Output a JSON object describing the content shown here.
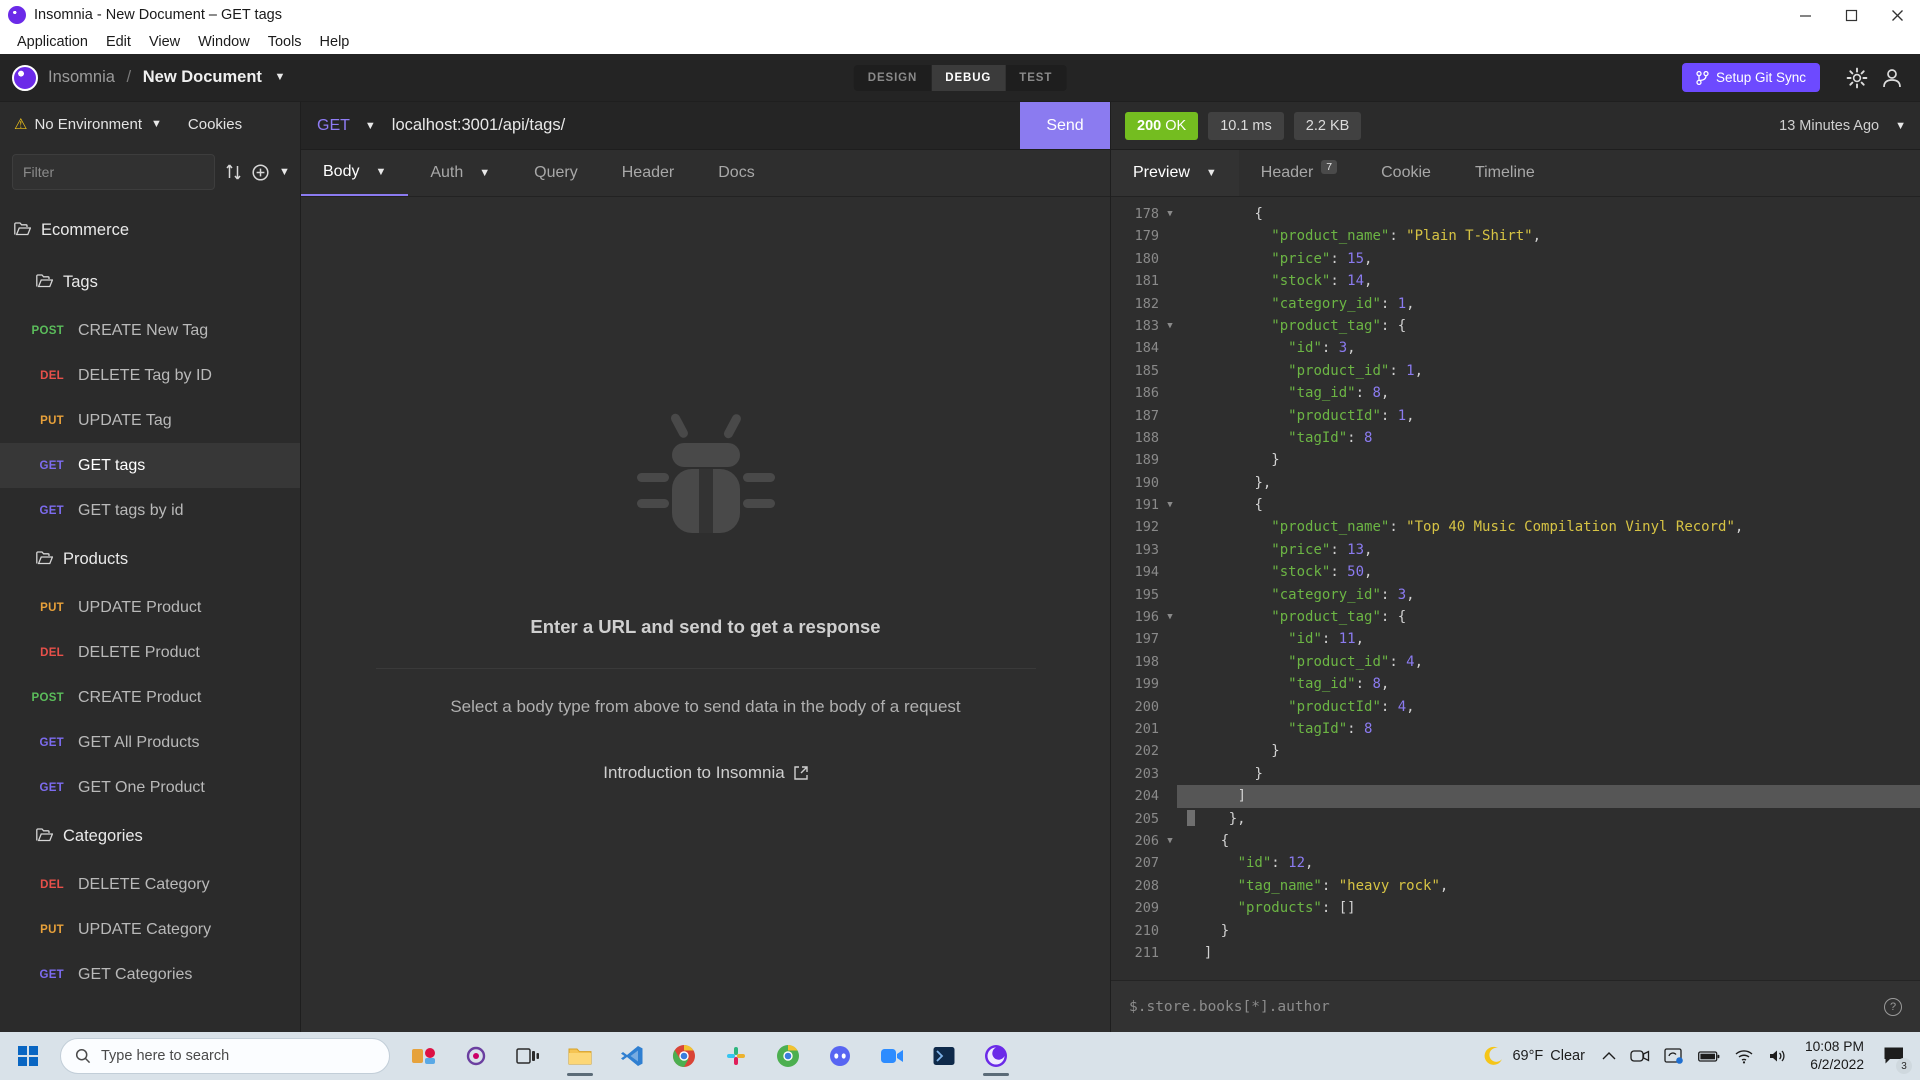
{
  "window": {
    "title": "Insomnia - New Document – GET tags",
    "minimize": "–",
    "maximize": "☐",
    "close": "✕"
  },
  "menubar": {
    "items": [
      "Application",
      "Edit",
      "View",
      "Window",
      "Tools",
      "Help"
    ]
  },
  "header": {
    "brand": "Insomnia",
    "separator": "/",
    "document": "New Document",
    "doc_caret": "▼",
    "modes": [
      {
        "label": "DESIGN",
        "active": false
      },
      {
        "label": "DEBUG",
        "active": true
      },
      {
        "label": "TEST",
        "active": false
      }
    ],
    "git_sync": "Setup Git Sync",
    "git_icon": "branch-icon",
    "settings_icon": "gear-icon",
    "account_icon": "user-icon"
  },
  "sidebar": {
    "environment": "No Environment",
    "environment_caret": "▼",
    "warning_icon": "⚠",
    "cookies": "Cookies",
    "filter_placeholder": "Filter",
    "sort_icon": "sort-icon",
    "add_icon": "plus-icon",
    "tree": [
      {
        "type": "folder",
        "level": 1,
        "label": "Ecommerce"
      },
      {
        "type": "folder",
        "level": 2,
        "label": "Tags"
      },
      {
        "type": "request",
        "method": "POST",
        "label": "CREATE New Tag",
        "selected": false
      },
      {
        "type": "request",
        "method": "DEL",
        "label": "DELETE Tag by ID",
        "selected": false
      },
      {
        "type": "request",
        "method": "PUT",
        "label": "UPDATE Tag",
        "selected": false
      },
      {
        "type": "request",
        "method": "GET",
        "label": "GET tags",
        "selected": true
      },
      {
        "type": "request",
        "method": "GET",
        "label": "GET tags by id",
        "selected": false
      },
      {
        "type": "folder",
        "level": 2,
        "label": "Products"
      },
      {
        "type": "request",
        "method": "PUT",
        "label": "UPDATE Product",
        "selected": false
      },
      {
        "type": "request",
        "method": "DEL",
        "label": "DELETE Product",
        "selected": false
      },
      {
        "type": "request",
        "method": "POST",
        "label": "CREATE Product",
        "selected": false
      },
      {
        "type": "request",
        "method": "GET",
        "label": "GET All Products",
        "selected": false
      },
      {
        "type": "request",
        "method": "GET",
        "label": "GET One Product",
        "selected": false
      },
      {
        "type": "folder",
        "level": 2,
        "label": "Categories"
      },
      {
        "type": "request",
        "method": "DEL",
        "label": "DELETE Category",
        "selected": false
      },
      {
        "type": "request",
        "method": "PUT",
        "label": "UPDATE Category",
        "selected": false
      },
      {
        "type": "request",
        "method": "GET",
        "label": "GET Categories",
        "selected": false
      }
    ]
  },
  "request": {
    "method": "GET",
    "method_caret": "▼",
    "url": "localhost:3001/api/tags/",
    "send_label": "Send",
    "tabs": [
      {
        "label": "Body",
        "active": true,
        "caret": "▼"
      },
      {
        "label": "Auth",
        "active": false,
        "caret": "▼"
      },
      {
        "label": "Query",
        "active": false,
        "caret": ""
      },
      {
        "label": "Header",
        "active": false,
        "caret": ""
      },
      {
        "label": "Docs",
        "active": false,
        "caret": ""
      }
    ],
    "empty_icon": "bug-icon",
    "empty_title": "Enter a URL and send to get a response",
    "empty_subtitle": "Select a body type from above to send data in the body of a request",
    "empty_link": "Introduction to Insomnia",
    "empty_link_icon": "external-link-icon"
  },
  "response": {
    "status_code": "200",
    "status_text": "OK",
    "time": "10.1 ms",
    "size": "2.2 KB",
    "ago": "13 Minutes Ago",
    "ago_caret": "▼",
    "tabs": [
      {
        "label": "Preview",
        "active": true,
        "caret": "▼",
        "badge": ""
      },
      {
        "label": "Header",
        "active": false,
        "caret": "",
        "badge": "7"
      },
      {
        "label": "Cookie",
        "active": false,
        "caret": "",
        "badge": ""
      },
      {
        "label": "Timeline",
        "active": false,
        "caret": "",
        "badge": ""
      }
    ],
    "filter_placeholder": "$.store.books[*].author",
    "help_icon": "question-icon",
    "code_lines": [
      {
        "num": 178,
        "fold": true,
        "indent": 4,
        "sel": false,
        "tokens": [
          {
            "t": "p",
            "v": "{"
          }
        ]
      },
      {
        "num": 179,
        "fold": false,
        "indent": 5,
        "sel": false,
        "tokens": [
          {
            "t": "k",
            "v": "\"product_name\""
          },
          {
            "t": "p",
            "v": ": "
          },
          {
            "t": "s",
            "v": "\"Plain T-Shirt\""
          },
          {
            "t": "p",
            "v": ","
          }
        ]
      },
      {
        "num": 180,
        "fold": false,
        "indent": 5,
        "sel": false,
        "tokens": [
          {
            "t": "k",
            "v": "\"price\""
          },
          {
            "t": "p",
            "v": ": "
          },
          {
            "t": "n",
            "v": "15"
          },
          {
            "t": "p",
            "v": ","
          }
        ]
      },
      {
        "num": 181,
        "fold": false,
        "indent": 5,
        "sel": false,
        "tokens": [
          {
            "t": "k",
            "v": "\"stock\""
          },
          {
            "t": "p",
            "v": ": "
          },
          {
            "t": "n",
            "v": "14"
          },
          {
            "t": "p",
            "v": ","
          }
        ]
      },
      {
        "num": 182,
        "fold": false,
        "indent": 5,
        "sel": false,
        "tokens": [
          {
            "t": "k",
            "v": "\"category_id\""
          },
          {
            "t": "p",
            "v": ": "
          },
          {
            "t": "n",
            "v": "1"
          },
          {
            "t": "p",
            "v": ","
          }
        ]
      },
      {
        "num": 183,
        "fold": true,
        "indent": 5,
        "sel": false,
        "tokens": [
          {
            "t": "k",
            "v": "\"product_tag\""
          },
          {
            "t": "p",
            "v": ": {"
          }
        ]
      },
      {
        "num": 184,
        "fold": false,
        "indent": 6,
        "sel": false,
        "tokens": [
          {
            "t": "k",
            "v": "\"id\""
          },
          {
            "t": "p",
            "v": ": "
          },
          {
            "t": "n",
            "v": "3"
          },
          {
            "t": "p",
            "v": ","
          }
        ]
      },
      {
        "num": 185,
        "fold": false,
        "indent": 6,
        "sel": false,
        "tokens": [
          {
            "t": "k",
            "v": "\"product_id\""
          },
          {
            "t": "p",
            "v": ": "
          },
          {
            "t": "n",
            "v": "1"
          },
          {
            "t": "p",
            "v": ","
          }
        ]
      },
      {
        "num": 186,
        "fold": false,
        "indent": 6,
        "sel": false,
        "tokens": [
          {
            "t": "k",
            "v": "\"tag_id\""
          },
          {
            "t": "p",
            "v": ": "
          },
          {
            "t": "n",
            "v": "8"
          },
          {
            "t": "p",
            "v": ","
          }
        ]
      },
      {
        "num": 187,
        "fold": false,
        "indent": 6,
        "sel": false,
        "tokens": [
          {
            "t": "k",
            "v": "\"productId\""
          },
          {
            "t": "p",
            "v": ": "
          },
          {
            "t": "n",
            "v": "1"
          },
          {
            "t": "p",
            "v": ","
          }
        ]
      },
      {
        "num": 188,
        "fold": false,
        "indent": 6,
        "sel": false,
        "tokens": [
          {
            "t": "k",
            "v": "\"tagId\""
          },
          {
            "t": "p",
            "v": ": "
          },
          {
            "t": "n",
            "v": "8"
          }
        ]
      },
      {
        "num": 189,
        "fold": false,
        "indent": 5,
        "sel": false,
        "tokens": [
          {
            "t": "p",
            "v": "}"
          }
        ]
      },
      {
        "num": 190,
        "fold": false,
        "indent": 4,
        "sel": false,
        "tokens": [
          {
            "t": "p",
            "v": "},"
          }
        ]
      },
      {
        "num": 191,
        "fold": true,
        "indent": 4,
        "sel": false,
        "tokens": [
          {
            "t": "p",
            "v": "{"
          }
        ]
      },
      {
        "num": 192,
        "fold": false,
        "indent": 5,
        "sel": false,
        "tokens": [
          {
            "t": "k",
            "v": "\"product_name\""
          },
          {
            "t": "p",
            "v": ": "
          },
          {
            "t": "s",
            "v": "\"Top 40 Music Compilation Vinyl Record\""
          },
          {
            "t": "p",
            "v": ","
          }
        ]
      },
      {
        "num": 193,
        "fold": false,
        "indent": 5,
        "sel": false,
        "tokens": [
          {
            "t": "k",
            "v": "\"price\""
          },
          {
            "t": "p",
            "v": ": "
          },
          {
            "t": "n",
            "v": "13"
          },
          {
            "t": "p",
            "v": ","
          }
        ]
      },
      {
        "num": 194,
        "fold": false,
        "indent": 5,
        "sel": false,
        "tokens": [
          {
            "t": "k",
            "v": "\"stock\""
          },
          {
            "t": "p",
            "v": ": "
          },
          {
            "t": "n",
            "v": "50"
          },
          {
            "t": "p",
            "v": ","
          }
        ]
      },
      {
        "num": 195,
        "fold": false,
        "indent": 5,
        "sel": false,
        "tokens": [
          {
            "t": "k",
            "v": "\"category_id\""
          },
          {
            "t": "p",
            "v": ": "
          },
          {
            "t": "n",
            "v": "3"
          },
          {
            "t": "p",
            "v": ","
          }
        ]
      },
      {
        "num": 196,
        "fold": true,
        "indent": 5,
        "sel": false,
        "tokens": [
          {
            "t": "k",
            "v": "\"product_tag\""
          },
          {
            "t": "p",
            "v": ": {"
          }
        ]
      },
      {
        "num": 197,
        "fold": false,
        "indent": 6,
        "sel": false,
        "tokens": [
          {
            "t": "k",
            "v": "\"id\""
          },
          {
            "t": "p",
            "v": ": "
          },
          {
            "t": "n",
            "v": "11"
          },
          {
            "t": "p",
            "v": ","
          }
        ]
      },
      {
        "num": 198,
        "fold": false,
        "indent": 6,
        "sel": false,
        "tokens": [
          {
            "t": "k",
            "v": "\"product_id\""
          },
          {
            "t": "p",
            "v": ": "
          },
          {
            "t": "n",
            "v": "4"
          },
          {
            "t": "p",
            "v": ","
          }
        ]
      },
      {
        "num": 199,
        "fold": false,
        "indent": 6,
        "sel": false,
        "tokens": [
          {
            "t": "k",
            "v": "\"tag_id\""
          },
          {
            "t": "p",
            "v": ": "
          },
          {
            "t": "n",
            "v": "8"
          },
          {
            "t": "p",
            "v": ","
          }
        ]
      },
      {
        "num": 200,
        "fold": false,
        "indent": 6,
        "sel": false,
        "tokens": [
          {
            "t": "k",
            "v": "\"productId\""
          },
          {
            "t": "p",
            "v": ": "
          },
          {
            "t": "n",
            "v": "4"
          },
          {
            "t": "p",
            "v": ","
          }
        ]
      },
      {
        "num": 201,
        "fold": false,
        "indent": 6,
        "sel": false,
        "tokens": [
          {
            "t": "k",
            "v": "\"tagId\""
          },
          {
            "t": "p",
            "v": ": "
          },
          {
            "t": "n",
            "v": "8"
          }
        ]
      },
      {
        "num": 202,
        "fold": false,
        "indent": 5,
        "sel": false,
        "tokens": [
          {
            "t": "p",
            "v": "}"
          }
        ]
      },
      {
        "num": 203,
        "fold": false,
        "indent": 4,
        "sel": false,
        "tokens": [
          {
            "t": "p",
            "v": "}"
          }
        ]
      },
      {
        "num": 204,
        "fold": false,
        "indent": 3,
        "sel": true,
        "tokens": [
          {
            "t": "p",
            "v": "]"
          }
        ]
      },
      {
        "num": 205,
        "fold": false,
        "indent": 2,
        "sel": false,
        "cursor": true,
        "tokens": [
          {
            "t": "p",
            "v": "},"
          }
        ]
      },
      {
        "num": 206,
        "fold": true,
        "indent": 2,
        "sel": false,
        "tokens": [
          {
            "t": "p",
            "v": "{"
          }
        ]
      },
      {
        "num": 207,
        "fold": false,
        "indent": 3,
        "sel": false,
        "tokens": [
          {
            "t": "k",
            "v": "\"id\""
          },
          {
            "t": "p",
            "v": ": "
          },
          {
            "t": "n",
            "v": "12"
          },
          {
            "t": "p",
            "v": ","
          }
        ]
      },
      {
        "num": 208,
        "fold": false,
        "indent": 3,
        "sel": false,
        "tokens": [
          {
            "t": "k",
            "v": "\"tag_name\""
          },
          {
            "t": "p",
            "v": ": "
          },
          {
            "t": "s",
            "v": "\"heavy rock\""
          },
          {
            "t": "p",
            "v": ","
          }
        ]
      },
      {
        "num": 209,
        "fold": false,
        "indent": 3,
        "sel": false,
        "tokens": [
          {
            "t": "k",
            "v": "\"products\""
          },
          {
            "t": "p",
            "v": ": []"
          }
        ]
      },
      {
        "num": 210,
        "fold": false,
        "indent": 2,
        "sel": false,
        "tokens": [
          {
            "t": "p",
            "v": "}"
          }
        ]
      },
      {
        "num": 211,
        "fold": false,
        "indent": 1,
        "sel": false,
        "tokens": [
          {
            "t": "p",
            "v": "]"
          }
        ]
      }
    ]
  },
  "taskbar": {
    "start_icon": "windows-start-icon",
    "search_placeholder": "Type here to search",
    "search_icon": "search-icon",
    "apps": [
      {
        "name": "widget-icon",
        "active": false
      },
      {
        "name": "cortana-icon",
        "active": false
      },
      {
        "name": "task-view-icon",
        "active": false
      },
      {
        "name": "file-explorer-icon",
        "active": true
      },
      {
        "name": "vscode-icon",
        "active": false
      },
      {
        "name": "chrome-icon",
        "active": false
      },
      {
        "name": "slack-icon",
        "active": false
      },
      {
        "name": "chrome-canary-icon",
        "active": false
      },
      {
        "name": "discord-icon",
        "active": false
      },
      {
        "name": "zoom-icon",
        "active": false
      },
      {
        "name": "terminal-icon",
        "active": false
      },
      {
        "name": "insomnia-icon",
        "active": true
      }
    ],
    "weather_temp": "69°F",
    "weather_cond": "Clear",
    "weather_icon": "moon-icon",
    "tray_icons": [
      "chevron-up-icon",
      "camera-icon",
      "onedrive-icon",
      "battery-icon",
      "wifi-icon",
      "volume-icon"
    ],
    "time": "10:08 PM",
    "date": "6/2/2022",
    "notification_count": "3",
    "notification_icon": "notification-icon"
  }
}
